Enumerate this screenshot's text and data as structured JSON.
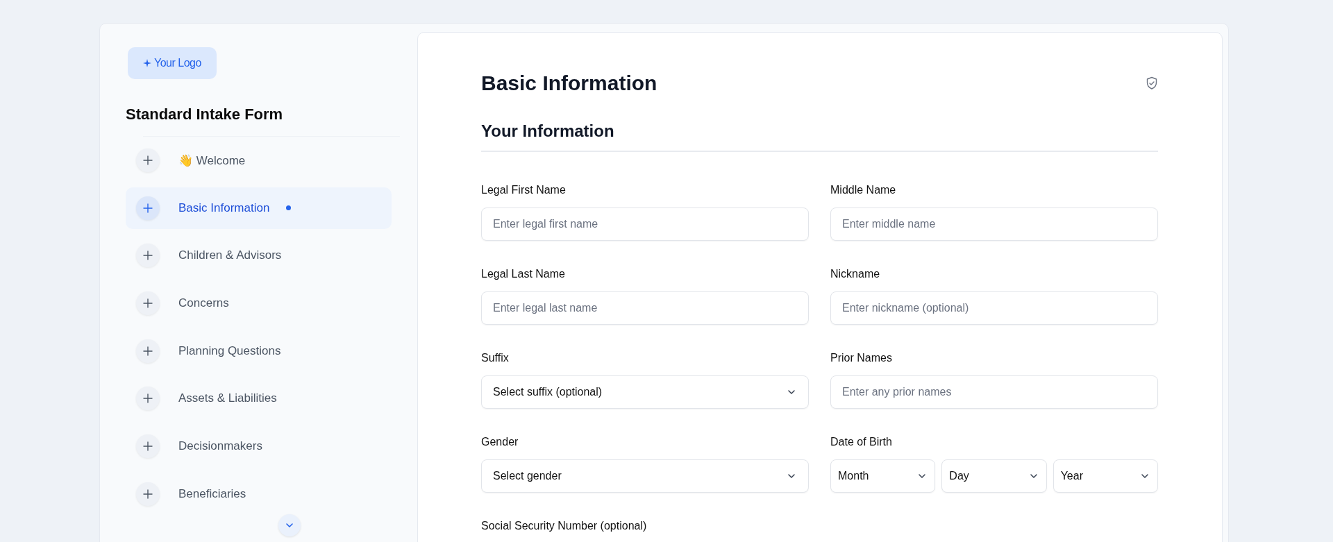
{
  "logo": {
    "text": "Your Logo"
  },
  "sidebar": {
    "title": "Standard Intake Form",
    "items": [
      {
        "label": "👋 Welcome",
        "selected": false
      },
      {
        "label": "Basic Information",
        "selected": true
      },
      {
        "label": "Children & Advisors",
        "selected": false
      },
      {
        "label": "Concerns",
        "selected": false
      },
      {
        "label": "Planning Questions",
        "selected": false
      },
      {
        "label": "Assets & Liabilities",
        "selected": false
      },
      {
        "label": "Decisionmakers",
        "selected": false
      },
      {
        "label": "Beneficiaries",
        "selected": false
      }
    ]
  },
  "page": {
    "title": "Basic Information",
    "section_title": "Your Information",
    "fields": [
      {
        "kind": "text",
        "label": "Legal First Name",
        "placeholder": "Enter legal first name"
      },
      {
        "kind": "text",
        "label": "Middle Name",
        "placeholder": "Enter middle name"
      },
      {
        "kind": "text",
        "label": "Legal Last Name",
        "placeholder": "Enter legal last name"
      },
      {
        "kind": "text",
        "label": "Nickname",
        "placeholder": "Enter nickname (optional)"
      },
      {
        "kind": "select",
        "label": "Suffix",
        "value": "Select suffix (optional)"
      },
      {
        "kind": "text",
        "label": "Prior Names",
        "placeholder": "Enter any prior names"
      },
      {
        "kind": "select",
        "label": "Gender",
        "value": "Select gender"
      },
      {
        "kind": "date",
        "label": "Date of Birth",
        "parts": [
          "Month",
          "Day",
          "Year"
        ]
      },
      {
        "kind": "text",
        "label": "Social Security Number (optional)"
      }
    ]
  }
}
